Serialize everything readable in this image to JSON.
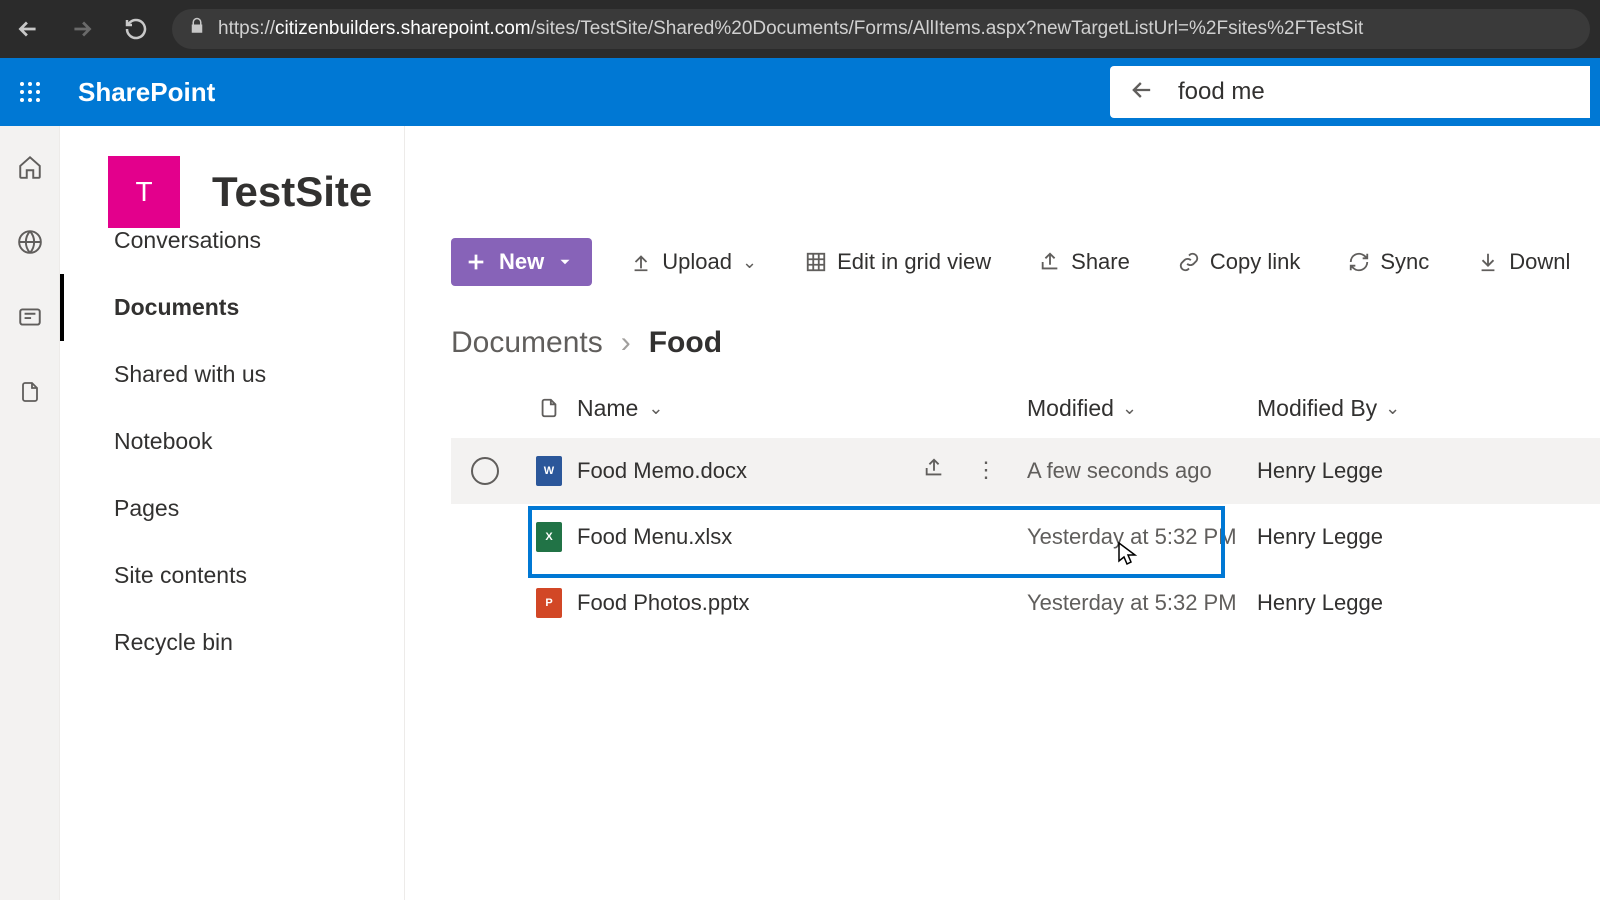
{
  "browser": {
    "url_prefix": "https://",
    "url_host": "citizenbuilders.sharepoint.com",
    "url_rest": "/sites/TestSite/Shared%20Documents/Forms/AllItems.aspx?newTargetListUrl=%2Fsites%2FTestSit"
  },
  "suite": {
    "title": "SharePoint",
    "search_value": "food me"
  },
  "site": {
    "logo_letter": "T",
    "name": "TestSite"
  },
  "nav": {
    "items": [
      {
        "label": "Home"
      },
      {
        "label": "Conversations"
      },
      {
        "label": "Documents"
      },
      {
        "label": "Shared with us"
      },
      {
        "label": "Notebook"
      },
      {
        "label": "Pages"
      },
      {
        "label": "Site contents"
      },
      {
        "label": "Recycle bin"
      }
    ],
    "active_index": 2
  },
  "toolbar": {
    "new_label": "New",
    "upload": "Upload",
    "edit_grid": "Edit in grid view",
    "share": "Share",
    "copy_link": "Copy link",
    "sync": "Sync",
    "download": "Downl"
  },
  "breadcrumb": {
    "root": "Documents",
    "current": "Food"
  },
  "columns": {
    "name": "Name",
    "modified": "Modified",
    "modified_by": "Modified By"
  },
  "rows": [
    {
      "icon": "word",
      "name": "Food Memo.docx",
      "modified": "A few seconds ago",
      "modified_by": "Henry Legge",
      "hover": true
    },
    {
      "icon": "excel",
      "name": "Food Menu.xlsx",
      "modified": "Yesterday at 5:32 PM",
      "modified_by": "Henry Legge",
      "hover": false
    },
    {
      "icon": "ppt",
      "name": "Food Photos.pptx",
      "modified": "Yesterday at 5:32 PM",
      "modified_by": "Henry Legge",
      "hover": false
    }
  ],
  "colors": {
    "accent": "#0078d4",
    "site_logo": "#e3008c",
    "new_btn": "#8763b8"
  }
}
